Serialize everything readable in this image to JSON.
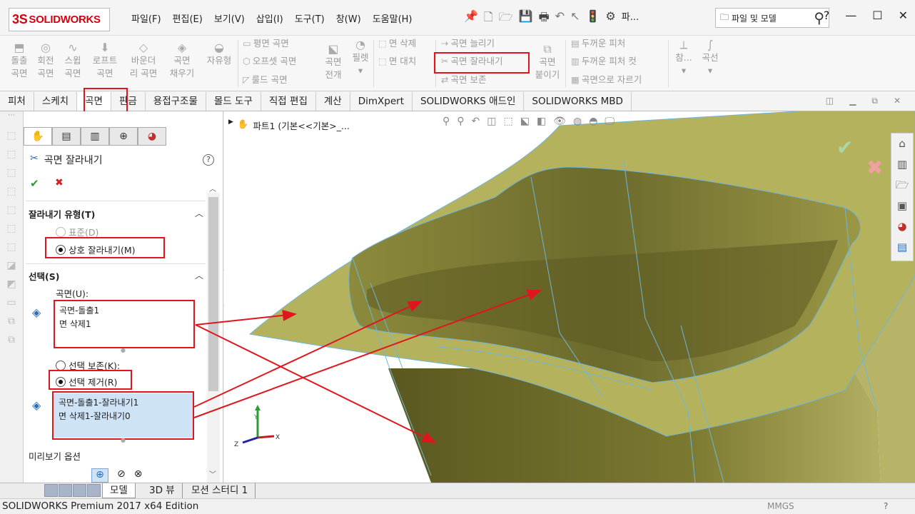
{
  "app": {
    "brand": "SOLIDWORKS",
    "brand_mark": "3S"
  },
  "menu": [
    "파일(F)",
    "편집(E)",
    "보기(V)",
    "삽입(I)",
    "도구(T)",
    "창(W)",
    "도움말(H)"
  ],
  "quick_access": {
    "overflow": "파..."
  },
  "search": {
    "placeholder": "파일 및 모델"
  },
  "window_controls": {
    "help": "?",
    "minimize": "—",
    "restore": "☐",
    "close": "✕"
  },
  "ribbon": {
    "big": [
      {
        "l1": "돌출",
        "l2": "곡면"
      },
      {
        "l1": "회전",
        "l2": "곡면"
      },
      {
        "l1": "스윕",
        "l2": "곡면"
      },
      {
        "l1": "로프트",
        "l2": "곡면"
      },
      {
        "l1": "바운더",
        "l2": "리 곡면"
      },
      {
        "l1": "곡면",
        "l2": "채우기"
      },
      {
        "l1": "자유형",
        "l2": ""
      }
    ],
    "group2": [
      "평면 곡면",
      "오프셋 곡면",
      "룰드 곡면"
    ],
    "unfold": {
      "l1": "곡면",
      "l2": "전개"
    },
    "fillet": "필렛",
    "group3": [
      "면 삭제",
      "면 대치"
    ],
    "group4": [
      "곡면 늘리기",
      "곡면 잘라내기",
      "곡면 보존"
    ],
    "knit": {
      "l1": "곡면",
      "l2": "붙이기"
    },
    "group5": [
      "두꺼운 피처",
      "두꺼운 피처 컷",
      "곡면으로 자르기"
    ],
    "ref": "참...",
    "curve": "곡선"
  },
  "tabs": [
    "피처",
    "스케치",
    "곡면",
    "판금",
    "용접구조물",
    "몰드 도구",
    "직접 편집",
    "계산",
    "DimXpert",
    "SOLIDWORKS 애드인",
    "SOLIDWORKS MBD"
  ],
  "property_manager": {
    "title": "곡면 잘라내기",
    "help": "?",
    "ok": "✔",
    "cancel": "✖",
    "trim_type": {
      "header": "잘라내기 유형(T)",
      "standard": "표준(D)",
      "mutual": "상호 잘라내기(M)"
    },
    "selections": {
      "header": "선택(S)",
      "surface_label": "곡면(U):",
      "surfaces": [
        "곡면-돌출1",
        "면 삭제1"
      ],
      "keep": "선택 보존(K):",
      "remove": "선택 제거(R)",
      "removed": [
        "곡면-돌출1-잘라내기1",
        "면 삭제1-잘라내기0"
      ]
    },
    "preview_header": "미리보기 옵션"
  },
  "viewport": {
    "tree_item": "파트1  (기본<<기본>_...",
    "triad": {
      "x": "X",
      "y": "Y",
      "z": "Z"
    },
    "ok": "✔",
    "cancel": "✖"
  },
  "bottom_tabs": [
    "모델",
    "3D 뷰",
    "모션 스터디 1"
  ],
  "status": {
    "edition": "SOLIDWORKS Premium 2017 x64 Edition",
    "units": "MMGS",
    "help": "?"
  }
}
